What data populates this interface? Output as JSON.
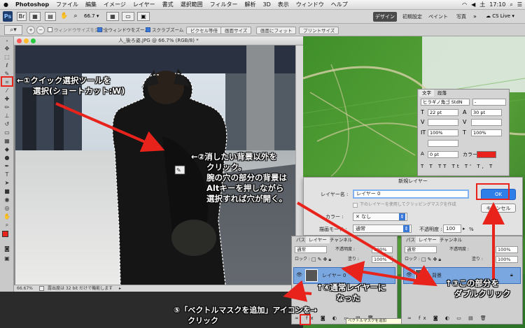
{
  "menubar": {
    "app_name": "Photoshop",
    "items": [
      "ファイル",
      "編集",
      "イメージ",
      "レイヤー",
      "書式",
      "選択範囲",
      "フィルター",
      "解析",
      "3D",
      "表示",
      "ウィンドウ",
      "ヘルプ"
    ],
    "status": {
      "day": "土",
      "time": "17:10"
    }
  },
  "appbar": {
    "zoom": "66.7",
    "workspaces": [
      "デザイン",
      "初期設定",
      "ペイント",
      "写真"
    ],
    "cs_live": "CS Live"
  },
  "options": {
    "cb_resize": "ウィンドウサイズを変更",
    "cb_all_windows": "全ウィンドウをズーム",
    "cb_scrubby": "スクラブズーム",
    "btn_actual": "ピクセル等倍",
    "btn_fit_screen": "画面サイズ",
    "btn_fill_screen": "画面にフィット",
    "btn_print": "プリントサイズ"
  },
  "document": {
    "title": "人_後ろ姿.JPG @ 66.7% (RGB/8) *",
    "zoom": "66.67%",
    "status": "露出度は 32 bit だけで機能します"
  },
  "char_panel": {
    "tabs": [
      "文字",
      "段落"
    ],
    "font": "ヒラギノ角ゴ StdN",
    "style": "-",
    "size": "22 pt",
    "leading": "30 pt",
    "scale_v": "100%",
    "scale_h": "100%",
    "baseline": "0 pt",
    "color_label": "カラー :",
    "color": "#e8231c"
  },
  "dialog": {
    "title": "新規レイヤー",
    "name_label": "レイヤー名 :",
    "name_value": "レイヤー 0",
    "clip_label": "下のレイヤーを使用してクリッピングマスクを作成",
    "color_label": "カラー :",
    "color_value": "なし",
    "mode_label": "描画モード :",
    "mode_value": "通常",
    "opacity_label": "不透明度 :",
    "opacity_value": "100",
    "opacity_unit": "%",
    "ok": "OK",
    "cancel": "キャンセル"
  },
  "layers_left": {
    "tabs": [
      "パス",
      "レイヤー",
      "チャンネル"
    ],
    "blend": "通常",
    "opacity_label": "不透明度 :",
    "opacity": "100%",
    "lock_label": "ロック :",
    "fill_label": "塗り :",
    "fill": "100%",
    "layer_name": "レイヤー 0",
    "tooltip": "ベクトルマスクを追加"
  },
  "layers_right": {
    "tabs": [
      "パス",
      "レイヤー",
      "チャンネル"
    ],
    "blend": "通常",
    "opacity_label": "不透明度 :",
    "opacity": "100%",
    "lock_label": "ロック :",
    "fill_label": "塗り :",
    "fill": "100%",
    "layer_name": "背景"
  },
  "annotations": {
    "step1_line1": "←①クイック選択ツールを",
    "step1_line2": "選択(ショートカット:W)",
    "step2_line1": "←②消したい背景以外を",
    "step2_line2": "クリック。",
    "step2_line3": "腕の穴の部分の背景は",
    "step2_line4": "Altキーを押しながら",
    "step2_line5": "選択すれば穴が開く。",
    "step3_line1": "↑③この部分を",
    "step3_line2": "ダブルクリック",
    "step4_line1": "↑④通常レイヤーに",
    "step4_line2": "なった",
    "step5_line1": "⑤「ベクトルマスクを追加」アイコンを→",
    "step5_line2": "クリック"
  },
  "colors": {
    "annotation_red": "#e8231c",
    "ok_blue": "#2f7fe8"
  }
}
